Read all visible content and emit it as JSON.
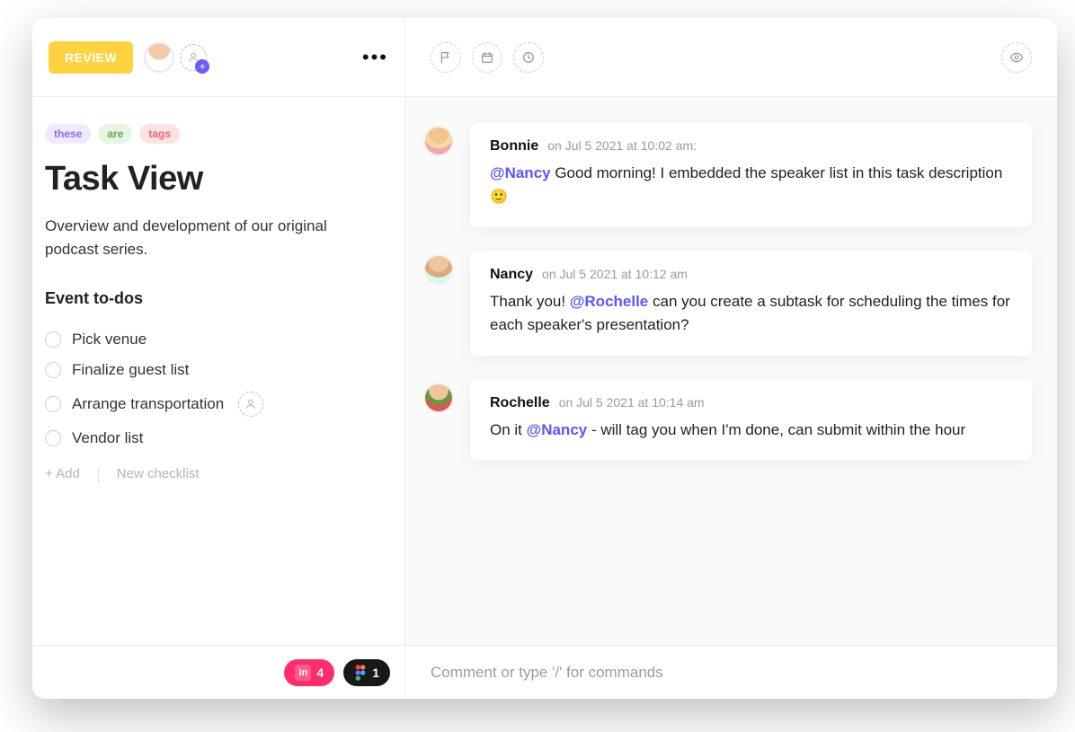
{
  "header": {
    "status": "REVIEW"
  },
  "tags": [
    {
      "label": "these",
      "bg": "#efeaff",
      "fg": "#8b6cff"
    },
    {
      "label": "are",
      "bg": "#e6f6e2",
      "fg": "#5bab52"
    },
    {
      "label": "tags",
      "bg": "#ffe2e2",
      "fg": "#ea6a6a"
    }
  ],
  "title": "Task View",
  "description": "Overview and development of our original podcast series.",
  "checklist": {
    "title": "Event to-dos",
    "items": [
      {
        "label": "Pick venue",
        "assignable": false
      },
      {
        "label": "Finalize guest list",
        "assignable": false
      },
      {
        "label": "Arrange transportation",
        "assignable": true
      },
      {
        "label": "Vendor list",
        "assignable": false
      }
    ],
    "add_label": "+ Add",
    "new_checklist_label": "New checklist"
  },
  "attachments": {
    "invision_count": "4",
    "figma_count": "1"
  },
  "comments": [
    {
      "author": "Bonnie",
      "time": "on Jul 5 2021 at 10:02 am:",
      "avatar": "b",
      "segments": [
        {
          "t": "mention",
          "v": "@Nancy"
        },
        {
          "t": "text",
          "v": " Good morning! I embedded the speaker list in this task description "
        },
        {
          "t": "emoji",
          "v": "🙂"
        }
      ]
    },
    {
      "author": "Nancy",
      "time": "on Jul 5 2021 at 10:12 am",
      "avatar": "n",
      "segments": [
        {
          "t": "text",
          "v": "Thank you! "
        },
        {
          "t": "mention",
          "v": "@Rochelle"
        },
        {
          "t": "text",
          "v": " can you create a subtask for scheduling the times for each speaker's presentation?"
        }
      ]
    },
    {
      "author": "Rochelle",
      "time": "on Jul 5 2021 at 10:14 am",
      "avatar": "r",
      "segments": [
        {
          "t": "text",
          "v": "On it "
        },
        {
          "t": "mention",
          "v": "@Nancy"
        },
        {
          "t": "text",
          "v": " - will tag you when I'm done, can submit within the hour"
        }
      ]
    }
  ],
  "compose_placeholder": "Comment or type '/' for commands"
}
